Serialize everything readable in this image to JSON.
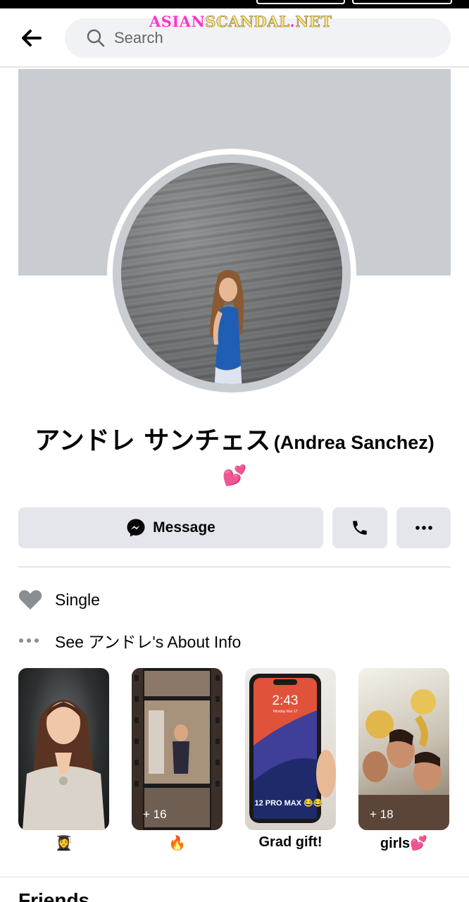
{
  "watermark": {
    "part1": "ASIAN",
    "part2": "SCANDAL",
    "dot": ".",
    "part3": "NET"
  },
  "search": {
    "placeholder": "Search"
  },
  "profile": {
    "name_jp": "アンドレ サンチェス",
    "name_en": "(Andrea Sanchez)",
    "bio": "💕"
  },
  "actions": {
    "message_label": "Message"
  },
  "info": {
    "relationship": "Single",
    "about_link": "See アンドレ's About Info"
  },
  "highlights": [
    {
      "label": "👩‍🎓",
      "count": ""
    },
    {
      "label": "🔥",
      "count": "+ 16"
    },
    {
      "label": "Grad gift!",
      "count": ""
    },
    {
      "label": "girls💕",
      "count": "+ 18"
    }
  ],
  "phone_screen": {
    "time": "2:43",
    "date": "Monday Mar 17",
    "caption": "12 PRO MAX 😂😂"
  },
  "next_section_peek": "Friends",
  "colors": {
    "cover": "#c9ccd1",
    "button_bg": "#e4e6eb",
    "search_bg": "#f0f2f5",
    "icon_gray": "#8a8d91",
    "messenger_black": "#050505"
  },
  "icons": {
    "back": "arrow-left-icon",
    "search": "magnifier-icon",
    "message": "messenger-icon",
    "call": "phone-icon",
    "more": "ellipsis-icon",
    "relationship": "heart-icon",
    "about": "dots-icon"
  }
}
